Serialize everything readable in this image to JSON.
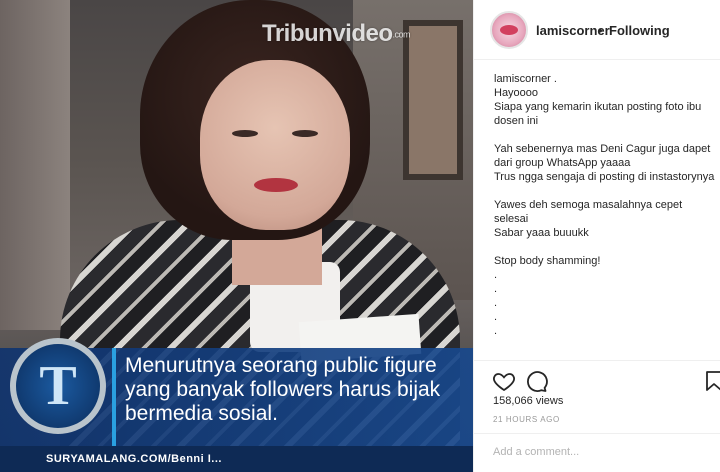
{
  "media": {
    "watermark": "Tribun",
    "watermark_suffix": "video",
    "watermark_small": ".com",
    "logo_letter": "T",
    "caption": "Menurutnya seorang public figure yang banyak followers harus bijak bermedia sosial.",
    "site_bar": "SURYAMALANG.COM/Benni I..."
  },
  "post": {
    "username": "lamiscorner",
    "separator": "•",
    "follow_status": "Following",
    "caption_user": "lamiscorner",
    "caption_user_suffix": " .",
    "caption_lines": {
      "l1": "Hayoooo",
      "l2": "Siapa yang kemarin ikutan posting foto ibu dosen ini",
      "l3": "Yah sebenernya mas Deni Cagur juga dapet dari group WhatsApp yaaaa",
      "l4": "Trus ngga sengaja di posting di instastorynya",
      "l5": "Yawes deh semoga masalahnya cepet selesai",
      "l6": "Sabar yaaa buuukk",
      "l7": "Stop body shamming!",
      "d1": ".",
      "d2": ".",
      "d3": ".",
      "d4": ".",
      "d5": "."
    },
    "views": "158,066 views",
    "time": "21 HOURS AGO",
    "comment_placeholder": "Add a comment..."
  },
  "icons": {
    "like": "heart-icon",
    "comment": "comment-icon",
    "save": "bookmark-icon"
  }
}
